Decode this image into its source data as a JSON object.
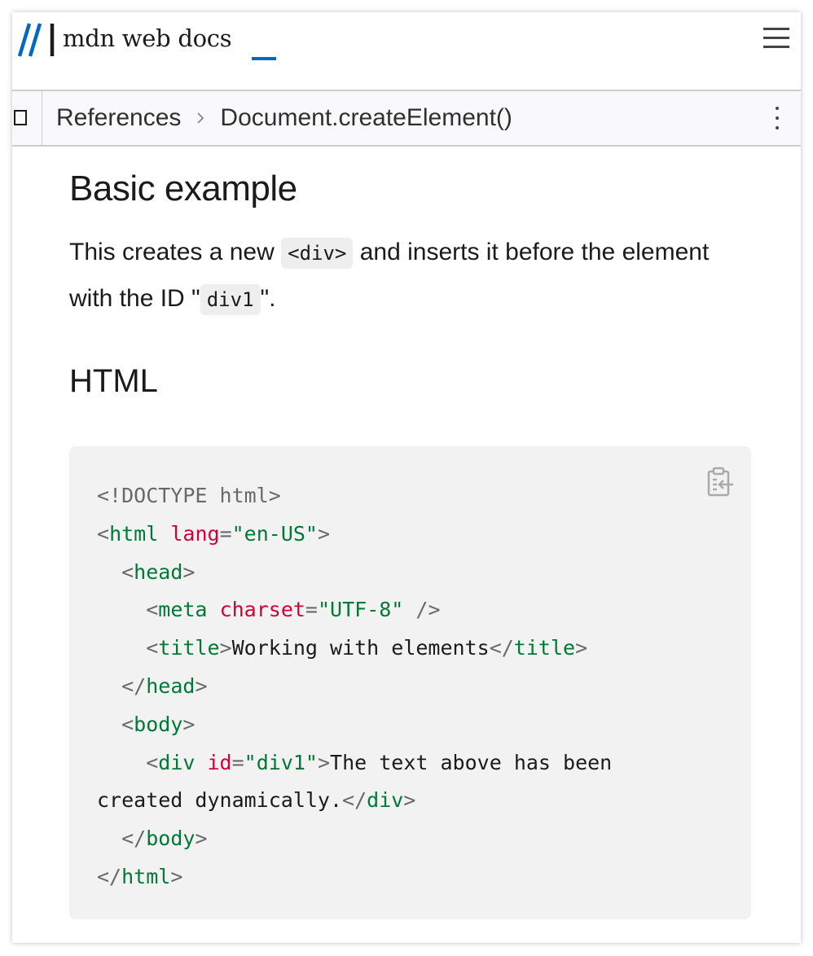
{
  "header": {
    "logo_text": "mdn web docs",
    "menu_icon": "hamburger-menu-icon",
    "accent_color": "#0069c2"
  },
  "breadcrumb": {
    "items": [
      {
        "label": "References"
      },
      {
        "label": "Document.createElement()"
      }
    ],
    "separator_icon": "chevron-right-icon",
    "more_icon": "vertical-ellipsis-icon",
    "sidebar_icon": "sidebar-toggle-icon"
  },
  "article": {
    "section_title": "Basic example",
    "desc_part1": "This creates a new ",
    "desc_code1": "<div>",
    "desc_part2": " and inserts it before the element with the ID \"",
    "desc_code2": "div1",
    "desc_part3": "\".",
    "subsection_title": "HTML"
  },
  "code_block": {
    "copy_icon": "clipboard-copy-icon",
    "lines": [
      [
        {
          "t": "doctype",
          "v": "<!DOCTYPE html>"
        }
      ],
      [
        {
          "t": "punct",
          "v": "<"
        },
        {
          "t": "tag",
          "v": "html"
        },
        {
          "t": "text",
          "v": " "
        },
        {
          "t": "attr",
          "v": "lang"
        },
        {
          "t": "punct",
          "v": "="
        },
        {
          "t": "val",
          "v": "\"en-US\""
        },
        {
          "t": "punct",
          "v": ">"
        }
      ],
      [
        {
          "t": "text",
          "v": "  "
        },
        {
          "t": "punct",
          "v": "<"
        },
        {
          "t": "tag",
          "v": "head"
        },
        {
          "t": "punct",
          "v": ">"
        }
      ],
      [
        {
          "t": "text",
          "v": "    "
        },
        {
          "t": "punct",
          "v": "<"
        },
        {
          "t": "tag",
          "v": "meta"
        },
        {
          "t": "text",
          "v": " "
        },
        {
          "t": "attr",
          "v": "charset"
        },
        {
          "t": "punct",
          "v": "="
        },
        {
          "t": "val",
          "v": "\"UTF-8\""
        },
        {
          "t": "text",
          "v": " "
        },
        {
          "t": "punct",
          "v": "/>"
        }
      ],
      [
        {
          "t": "text",
          "v": "    "
        },
        {
          "t": "punct",
          "v": "<"
        },
        {
          "t": "tag",
          "v": "title"
        },
        {
          "t": "punct",
          "v": ">"
        },
        {
          "t": "text",
          "v": "Working with elements"
        },
        {
          "t": "punct",
          "v": "</"
        },
        {
          "t": "tag",
          "v": "title"
        },
        {
          "t": "punct",
          "v": ">"
        }
      ],
      [
        {
          "t": "text",
          "v": "  "
        },
        {
          "t": "punct",
          "v": "</"
        },
        {
          "t": "tag",
          "v": "head"
        },
        {
          "t": "punct",
          "v": ">"
        }
      ],
      [
        {
          "t": "text",
          "v": "  "
        },
        {
          "t": "punct",
          "v": "<"
        },
        {
          "t": "tag",
          "v": "body"
        },
        {
          "t": "punct",
          "v": ">"
        }
      ],
      [
        {
          "t": "text",
          "v": "    "
        },
        {
          "t": "punct",
          "v": "<"
        },
        {
          "t": "tag",
          "v": "div"
        },
        {
          "t": "text",
          "v": " "
        },
        {
          "t": "attr",
          "v": "id"
        },
        {
          "t": "punct",
          "v": "="
        },
        {
          "t": "val",
          "v": "\"div1\""
        },
        {
          "t": "punct",
          "v": ">"
        },
        {
          "t": "text",
          "v": "The text above has been"
        }
      ],
      [
        {
          "t": "text",
          "v": "created dynamically."
        },
        {
          "t": "punct",
          "v": "</"
        },
        {
          "t": "tag",
          "v": "div"
        },
        {
          "t": "punct",
          "v": ">"
        }
      ],
      [
        {
          "t": "text",
          "v": "  "
        },
        {
          "t": "punct",
          "v": "</"
        },
        {
          "t": "tag",
          "v": "body"
        },
        {
          "t": "punct",
          "v": ">"
        }
      ],
      [
        {
          "t": "punct",
          "v": "</"
        },
        {
          "t": "tag",
          "v": "html"
        },
        {
          "t": "punct",
          "v": ">"
        }
      ]
    ]
  }
}
